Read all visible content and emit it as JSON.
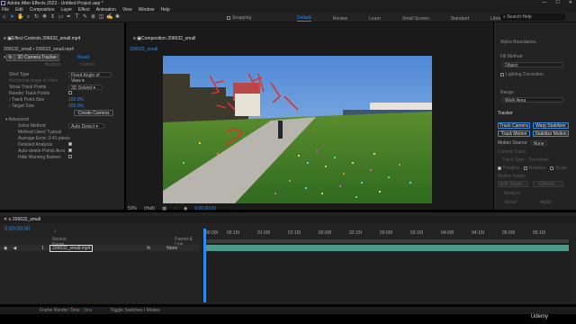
{
  "app": {
    "window_title": "Adobe After Effects 2023 - Untitled Project.aep *",
    "window_controls": [
      "—",
      "☐",
      "✕"
    ]
  },
  "menu": [
    "File",
    "Edit",
    "Composition",
    "Layer",
    "Effect",
    "Animation",
    "View",
    "Window",
    "Help"
  ],
  "toolbar": {
    "snapping_label": "Snapping",
    "workspaces": [
      "Default",
      "Review",
      "Learn",
      "Small Screen",
      "Standard",
      "Libraries"
    ],
    "search_placeholder": "Search Help"
  },
  "effect_controls": {
    "tab_label": "Effect Controls 206632_small.mp4",
    "subtitle": "206632_small • 206632_small.mp4",
    "effect_name": "3D Camera Tracker",
    "reset_label": "Reset",
    "analyze_label": "Analyze",
    "cancel_label": "Cancel",
    "props": [
      {
        "label": "Shot Type",
        "value": "Fixed Angle of View"
      },
      {
        "label": "Horizontal Angle of View",
        "value": ""
      },
      {
        "label": "Show Track Points",
        "value": "3D Solved"
      },
      {
        "label": "Render Track Points",
        "value": ""
      },
      {
        "label": "Track Point Size",
        "value": "100.0%"
      },
      {
        "label": "Target Size",
        "value": "100.0%"
      }
    ],
    "create_camera_label": "Create Camera",
    "advanced_label": "Advanced",
    "advanced_props": [
      {
        "label": "Solve Method",
        "value": "Auto Detect"
      },
      {
        "label": "Method Used: Typical",
        "value": ""
      },
      {
        "label": "Average Error: 0.41 pixels",
        "value": ""
      },
      {
        "label": "Detailed Analysis",
        "value": ""
      },
      {
        "label": "Auto-delete Points Acro",
        "value": ""
      },
      {
        "label": "Hide Warning Banner",
        "value": ""
      }
    ]
  },
  "composition": {
    "tab_label": "Composition 206632_small",
    "comp_name": "206632_small",
    "zoom": "50%",
    "resolution": "(Half)",
    "timecode": "0;00;00;00"
  },
  "right_panel": {
    "alpha_label": "Alpha Boundaries",
    "fill_label": "Fill Method",
    "fill_value": "Object",
    "lighting_label": "Lighting Correction",
    "range_label": "Range",
    "range_value": "Work Area",
    "tracker_title": "Tracker",
    "buttons": [
      "Track Camera",
      "Warp Stabilizer",
      "Track Motion",
      "Stabilize Motion"
    ],
    "motion_source_label": "Motion Source:",
    "motion_source_value": "None",
    "current_track_label": "Current Track:",
    "track_type_label": "Track Type:",
    "track_type_value": "Transform",
    "checks": [
      "Position",
      "Rotation",
      "Scale"
    ],
    "motion_target_label": "Motion Target:",
    "edit_target_label": "Edit Target...",
    "options_label": "Options...",
    "analyze_label": "Analyze:",
    "reset_label": "Reset",
    "apply_label": "Apply"
  },
  "timeline": {
    "tab_label": "206632_small",
    "timecode": "0;00;00;00",
    "columns": [
      "Source Name",
      "Parent & Link"
    ],
    "layer": {
      "index": "1",
      "name": "206632_small.mp4",
      "parent": "None"
    },
    "ruler_labels": [
      "00:00f",
      "00:15f",
      "01:00f",
      "01:15f",
      "02:00f",
      "02:15f",
      "03:00f",
      "03:15f",
      "04:00f",
      "04:15f",
      "05:00f",
      "05:15f"
    ]
  },
  "statusbar": {
    "render_time_label": "Frame Render Time:",
    "render_time_value": "0ms",
    "toggle_label": "Toggle Switches / Modes"
  },
  "watermark": "Udemy",
  "colors": {
    "accent": "#2d8ceb",
    "layer_bar": "#4d9a8b",
    "annotation": "#d93434"
  }
}
